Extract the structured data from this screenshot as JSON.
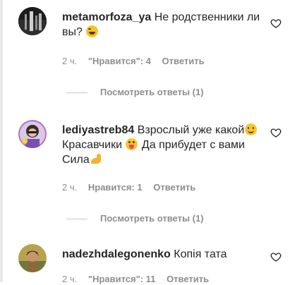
{
  "comments": [
    {
      "username": "metamorfoza_ya",
      "text_parts": [
        "Не родственники ли вы?"
      ],
      "emojis": [
        "laughing-emoji"
      ],
      "time": "2 ч.",
      "likes": "\"Нравится\": 4",
      "reply": "Ответить",
      "view_replies": "Посмотреть ответы (1)"
    },
    {
      "username": "lediyastreb84",
      "text_parts": [
        "Взрослый уже какой",
        "Красавчики",
        "Да прибудет с вами Сила"
      ],
      "emojis": [
        "smiling-emoji",
        "tongue-emoji",
        "flexed-bicep-emoji"
      ],
      "time": "2 ч.",
      "likes": "Нравится: 1",
      "reply": "Ответить",
      "view_replies": "Посмотреть ответы (1)"
    },
    {
      "username": "nadezhdalegonenko",
      "text_parts": [
        "Копія тата"
      ],
      "emojis": [],
      "time": "2 ч.",
      "likes": "\"Нравится\": 11",
      "reply": "Ответить"
    }
  ],
  "icons": {
    "like": "heart-outline-icon"
  },
  "colors": {
    "text": "#262626",
    "secondary": "#8e8e8e",
    "divider": "#c7c7c7"
  }
}
